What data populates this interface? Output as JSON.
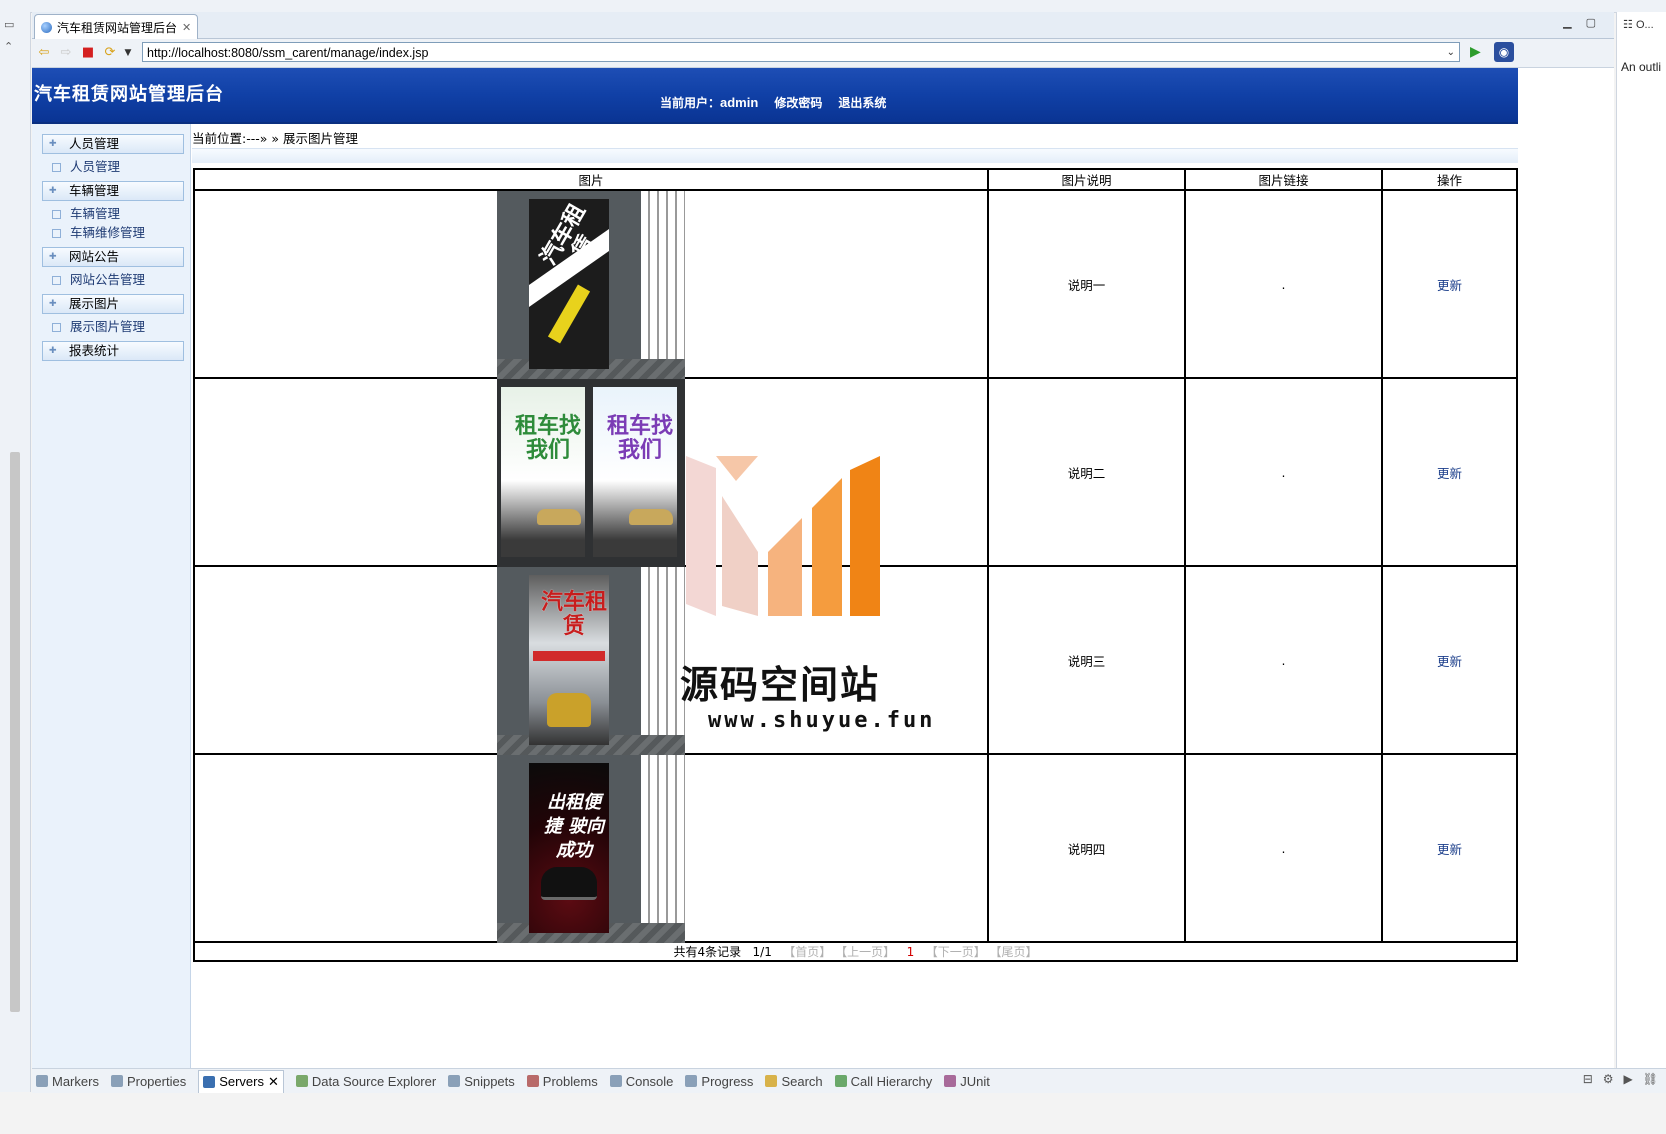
{
  "browser": {
    "tab_title": "汽车租赁网站管理后台",
    "url": "http://localhost:8080/ssm_carent/manage/index.jsp"
  },
  "header": {
    "site_title": "汽车租赁网站管理后台",
    "current_user_label": "当前用户：",
    "username": "admin",
    "change_password": "修改密码",
    "logout": "退出系统"
  },
  "sidebar": {
    "groups": [
      {
        "label": "人员管理",
        "items": [
          "人员管理"
        ]
      },
      {
        "label": "车辆管理",
        "items": [
          "车辆管理",
          "车辆维修管理"
        ]
      },
      {
        "label": "网站公告",
        "items": [
          "网站公告管理"
        ]
      },
      {
        "label": "展示图片",
        "items": [
          "展示图片管理"
        ]
      },
      {
        "label": "报表统计",
        "items": []
      }
    ]
  },
  "breadcrumb": "当前位置:---» » 展示图片管理",
  "table": {
    "columns": [
      "图片",
      "图片说明",
      "图片链接",
      "操作"
    ],
    "rows": [
      {
        "description": "说明一",
        "link": ".",
        "action": "更新",
        "poster_text": "汽车租赁"
      },
      {
        "description": "说明二",
        "link": ".",
        "action": "更新",
        "poster_text": "租车找我们"
      },
      {
        "description": "说明三",
        "link": ".",
        "action": "更新",
        "poster_text": "汽车租赁"
      },
      {
        "description": "说明四",
        "link": ".",
        "action": "更新",
        "poster_text": "出租便捷 驶向成功"
      }
    ]
  },
  "pager": {
    "total": "共有4条记录",
    "page_info": "1/1",
    "first": "【首页】",
    "prev": "【上一页】",
    "current": "1",
    "next": "【下一页】",
    "last": "【尾页】"
  },
  "watermark": {
    "name": "源码空间站",
    "url": "www.shuyue.fun"
  },
  "outline_panel": {
    "tab": "O...",
    "message": "An outli"
  },
  "bottom_tabs": [
    "Markers",
    "Properties",
    "Servers",
    "Data Source Explorer",
    "Snippets",
    "Problems",
    "Console",
    "Progress",
    "Search",
    "Call Hierarchy",
    "JUnit"
  ],
  "active_bottom_tab": "Servers"
}
